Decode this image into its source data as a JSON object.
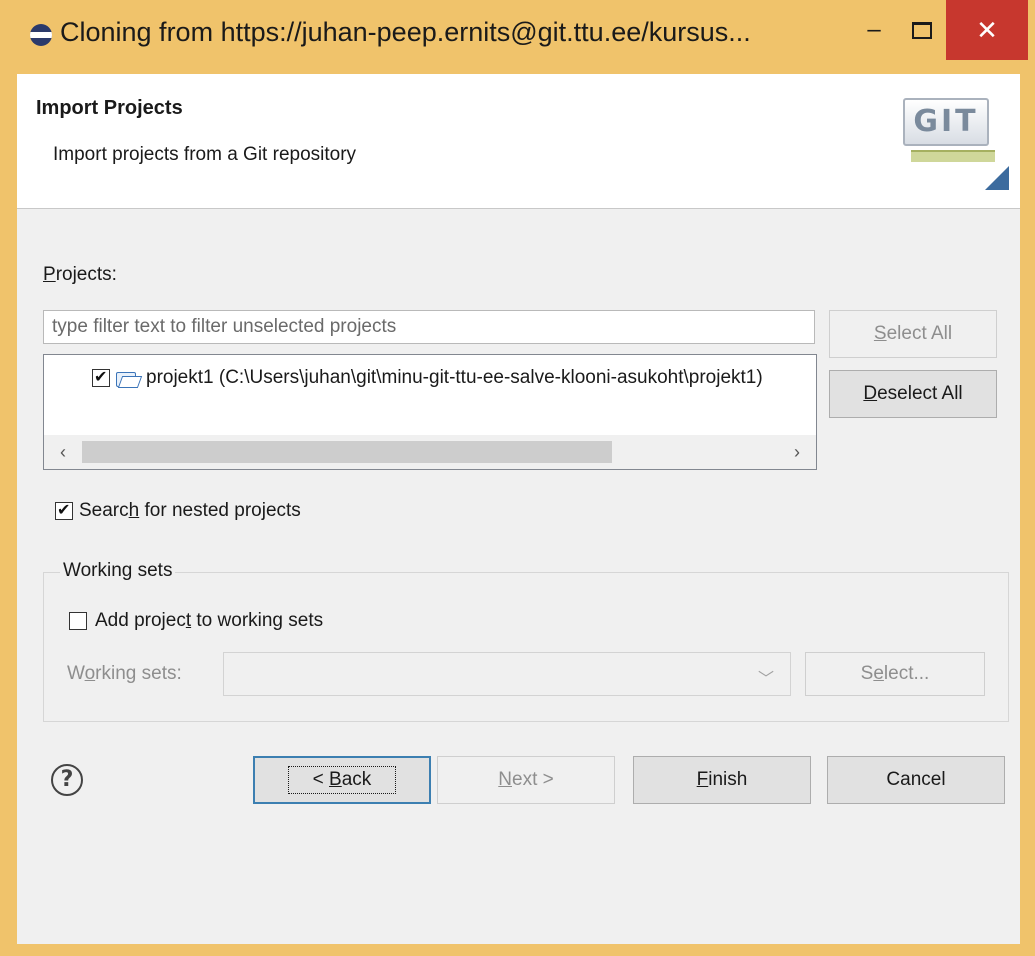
{
  "window": {
    "title": "Cloning from https://juhan-peep.ernits@git.ttu.ee/kursus...",
    "minimize": "–",
    "close": "✕"
  },
  "header": {
    "title": "Import Projects",
    "description": "Import projects from a Git repository",
    "logo_text": "GIT"
  },
  "projects": {
    "label_u": "P",
    "label_rest": "rojects:",
    "filter_placeholder": "type filter text to filter unselected projects",
    "items": [
      {
        "label": "projekt1 (C:\\Users\\juhan\\git\\minu-git-ttu-ee-salve-klooni-asukoht\\projekt1)",
        "checked": true
      }
    ],
    "select_all_u": "S",
    "select_all_rest": "elect All",
    "deselect_all_u": "D",
    "deselect_all_rest": "eselect All",
    "scroll_left": "‹",
    "scroll_right": "›"
  },
  "nested": {
    "pre": "Searc",
    "u": "h",
    "post": " for nested projects",
    "checked": true
  },
  "working_sets": {
    "group_title": "Working sets",
    "add_pre": "Add projec",
    "add_u": "t",
    "add_post": " to working sets",
    "add_checked": false,
    "ws_pre": "W",
    "ws_u": "o",
    "ws_post": "rking sets:",
    "combo_value": "",
    "select_pre": "S",
    "select_u": "e",
    "select_post": "lect..."
  },
  "footer": {
    "help": "?",
    "back_pre": "< ",
    "back_u": "B",
    "back_post": "ack",
    "next_u": "N",
    "next_post": "ext >",
    "finish_u": "F",
    "finish_post": "inish",
    "cancel": "Cancel"
  }
}
